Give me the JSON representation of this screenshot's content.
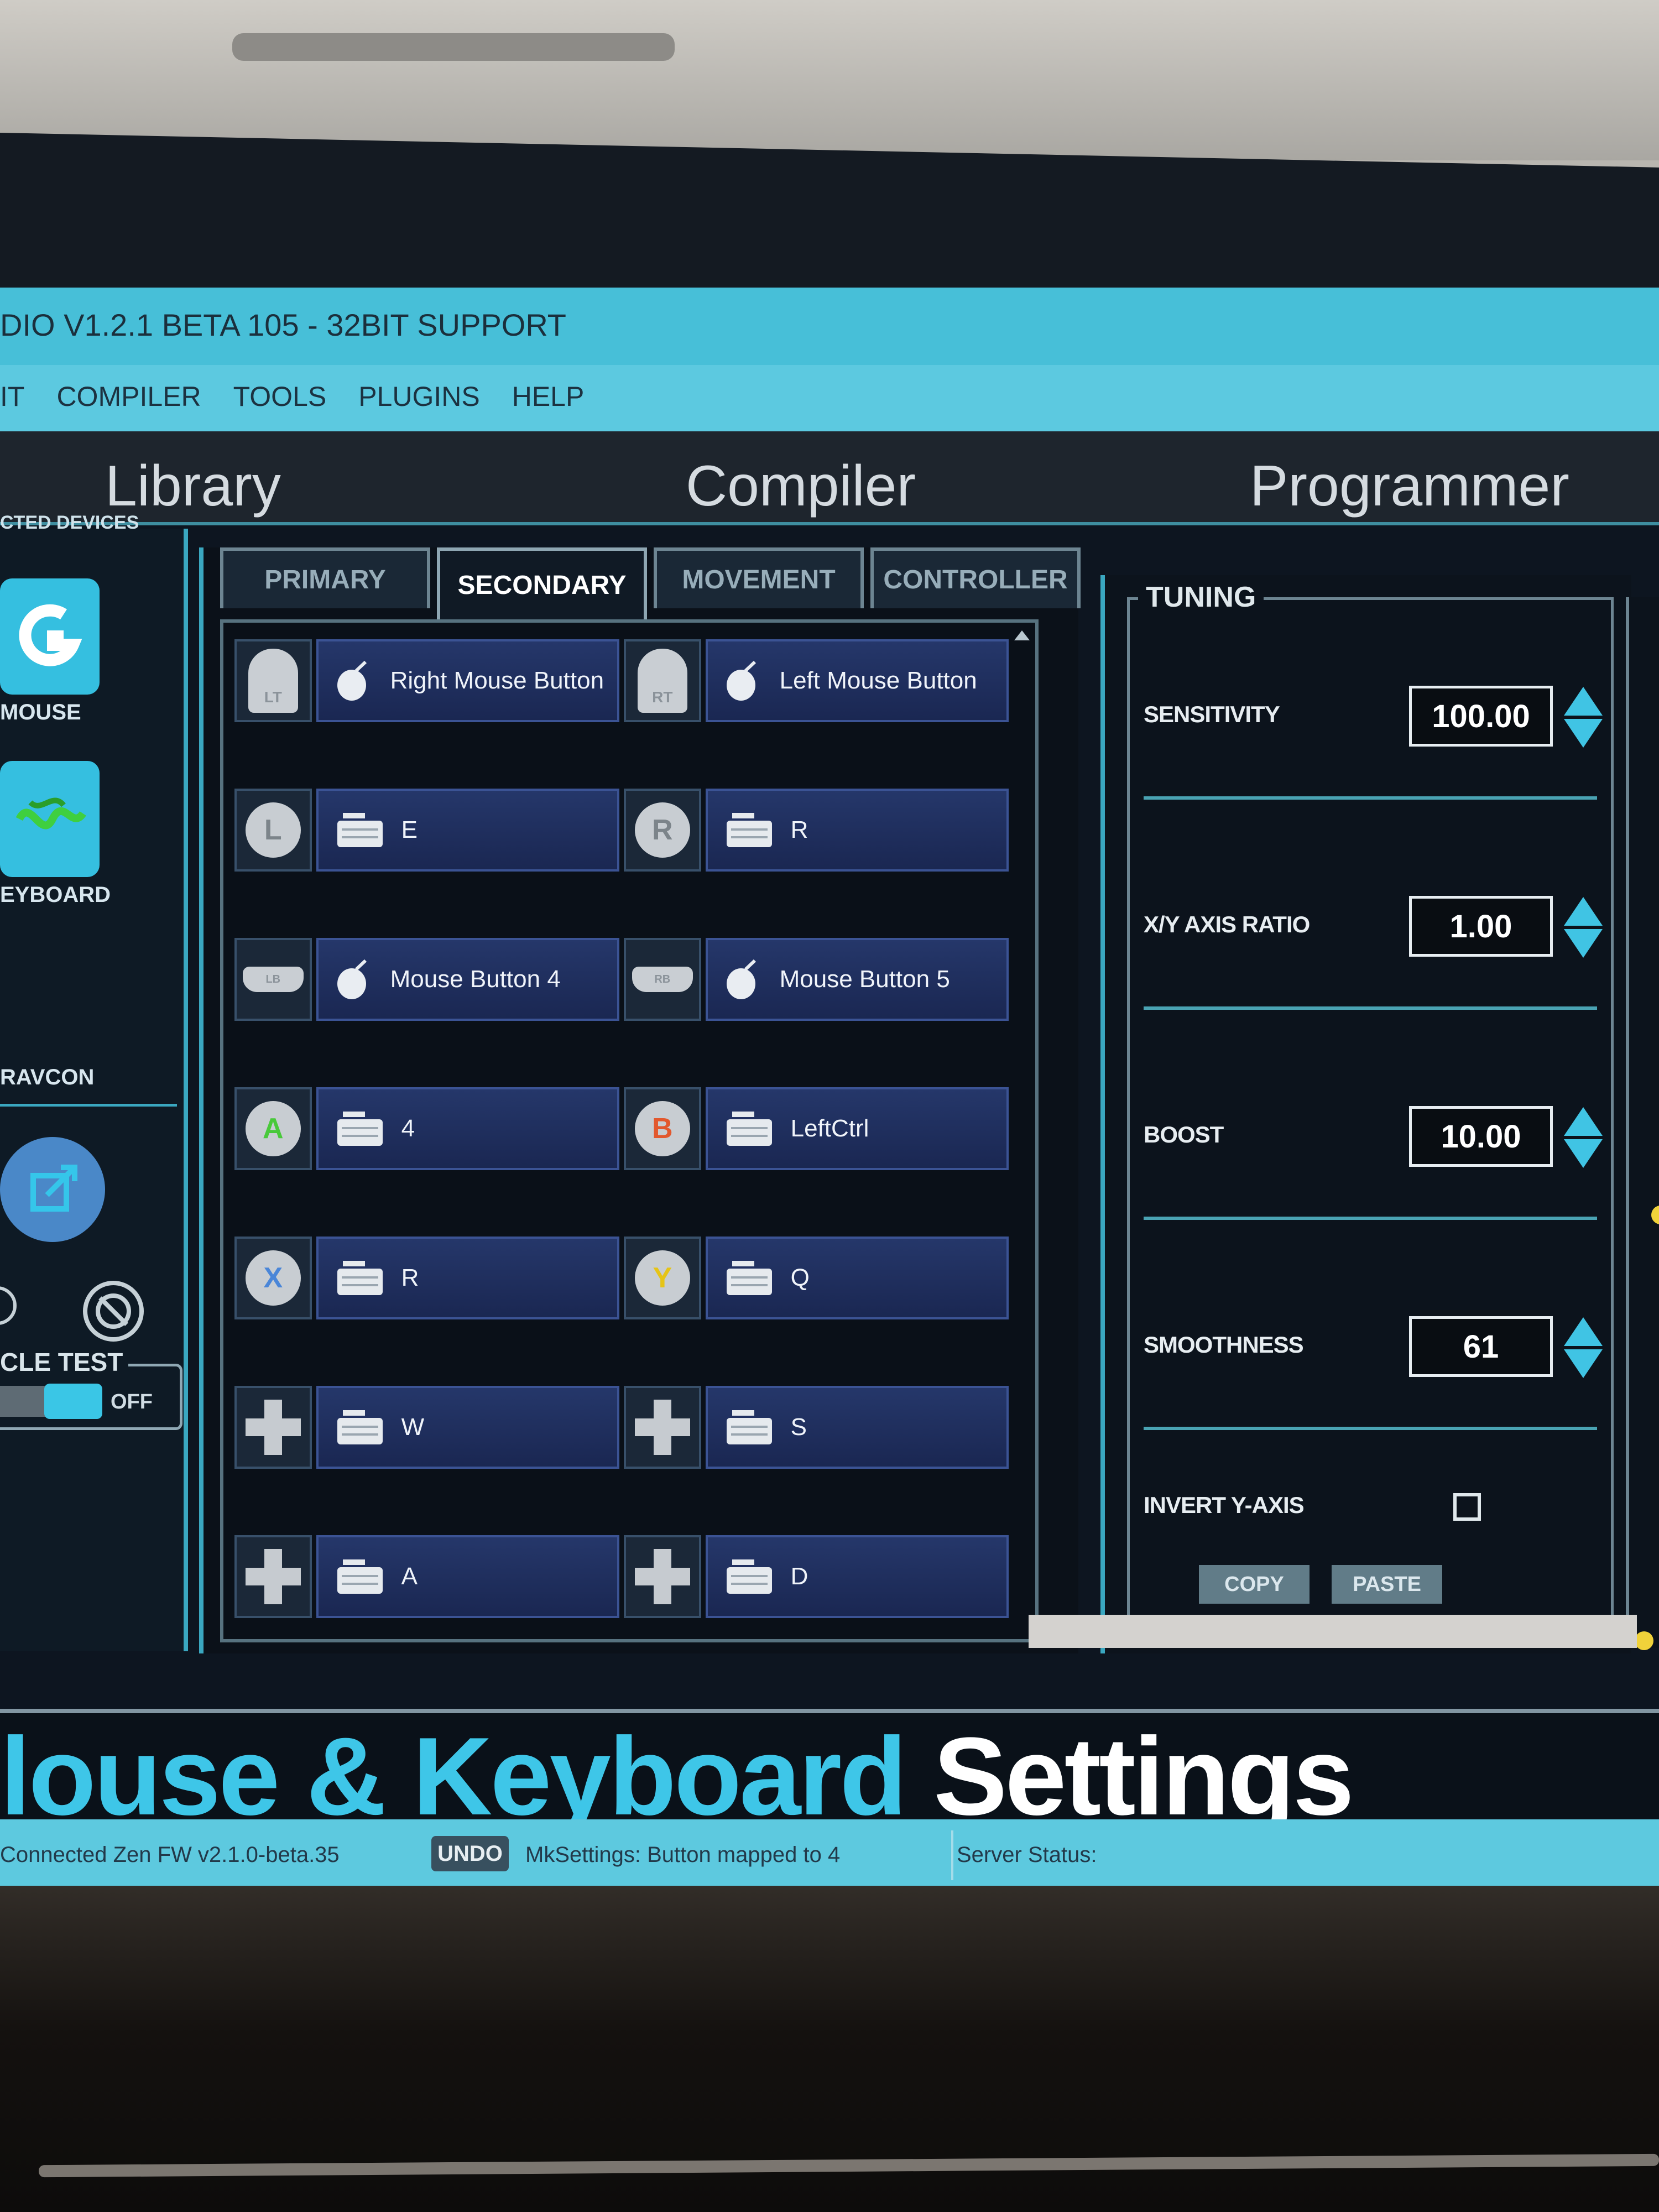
{
  "window": {
    "title": "DIO V1.2.1 BETA 105 - 32BIT SUPPORT",
    "menu": [
      "IT",
      "COMPILER",
      "TOOLS",
      "PLUGINS",
      "HELP"
    ]
  },
  "sections": {
    "library": "Library",
    "compiler": "Compiler",
    "programmer": "Programmer"
  },
  "devices": {
    "heading": "CTED DEVICES",
    "items": [
      {
        "label": "MOUSE",
        "icon": "logitech-g-icon"
      },
      {
        "label": "EYBOARD",
        "icon": "razer-snake-icon"
      },
      {
        "label": "RAVCON",
        "icon": "converter-icon"
      }
    ],
    "toggle": {
      "title": "CLE TEST",
      "state": "OFF"
    }
  },
  "tabs": [
    {
      "label": "PRIMARY",
      "active": false
    },
    {
      "label": "SECONDARY",
      "active": true
    },
    {
      "label": "MOVEMENT",
      "active": false
    },
    {
      "label": "CONTROLLER",
      "active": false
    }
  ],
  "mappings": [
    {
      "left_ctrl": "LT",
      "left_icon": "mouse-icon",
      "left_bind": "Right Mouse Button",
      "right_ctrl": "RT",
      "right_icon": "mouse-icon",
      "right_bind": "Left Mouse Button"
    },
    {
      "left_ctrl": "L",
      "left_icon": "keyboard-icon",
      "left_bind": "E",
      "right_ctrl": "R",
      "right_icon": "keyboard-icon",
      "right_bind": "R"
    },
    {
      "left_ctrl": "LB",
      "left_icon": "mouse-icon",
      "left_bind": "Mouse Button 4",
      "right_ctrl": "RB",
      "right_icon": "mouse-icon",
      "right_bind": "Mouse Button 5"
    },
    {
      "left_ctrl": "A",
      "left_icon": "keyboard-icon",
      "left_bind": "4",
      "right_ctrl": "B",
      "right_icon": "keyboard-icon",
      "right_bind": "LeftCtrl"
    },
    {
      "left_ctrl": "X",
      "left_icon": "keyboard-icon",
      "left_bind": "R",
      "right_ctrl": "Y",
      "right_icon": "keyboard-icon",
      "right_bind": "Q"
    },
    {
      "left_ctrl": "dpad-up",
      "left_icon": "keyboard-icon",
      "left_bind": "W",
      "right_ctrl": "dpad-down",
      "right_icon": "keyboard-icon",
      "right_bind": "S"
    },
    {
      "left_ctrl": "dpad-left",
      "left_icon": "keyboard-icon",
      "left_bind": "A",
      "right_ctrl": "dpad-right",
      "right_icon": "keyboard-icon",
      "right_bind": "D"
    }
  ],
  "tuning": {
    "title": "TUNING",
    "sensitivity": {
      "label": "SENSITIVITY",
      "value": "100.00"
    },
    "xy_ratio": {
      "label": "X/Y AXIS RATIO",
      "value": "1.00"
    },
    "boost": {
      "label": "BOOST",
      "value": "10.00"
    },
    "smoothness": {
      "label": "SMOOTHNESS",
      "value": "61"
    },
    "invert_y": {
      "label": "INVERT Y-AXIS",
      "checked": false
    },
    "copy": "COPY",
    "paste": "PASTE"
  },
  "footer": {
    "title_part1": "louse & Keyboard",
    "title_part2": " Settings"
  },
  "status": {
    "connected": "Connected Zen FW v2.1.0-beta.35",
    "undo": "UNDO",
    "message": "MkSettings: Button mapped to 4",
    "server": "Server Status:"
  },
  "colors": {
    "accent": "#47bfd8",
    "panel": "#0d1520",
    "binding": "#25376a",
    "highlight_yellow": "#f0d23a"
  }
}
